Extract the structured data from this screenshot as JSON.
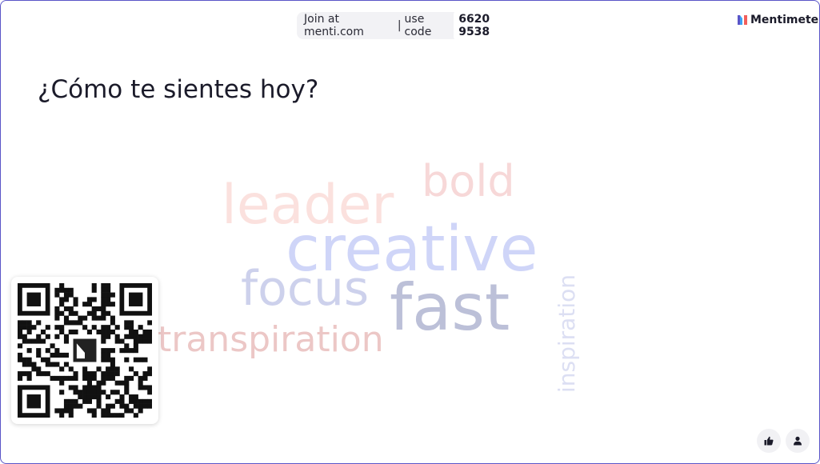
{
  "header": {
    "join_prefix": "Join at menti.com",
    "separator": "|",
    "use_code_label": "use code",
    "code": "6620 9538"
  },
  "brand": {
    "name": "Mentimeter",
    "logo_icon": "mentimeter-logo-icon"
  },
  "question": "¿Cómo te sientes hoy?",
  "word_cloud": {
    "words": [
      {
        "text": "bold",
        "color": "#f7d8d8"
      },
      {
        "text": "leader",
        "color": "#fbe1de"
      },
      {
        "text": "creative",
        "color": "#cfd5f8"
      },
      {
        "text": "focus",
        "color": "#cdd1ec"
      },
      {
        "text": "fast",
        "color": "#bcc0d8"
      },
      {
        "text": "transpiration",
        "color": "#ecc7c6"
      },
      {
        "text": "inspiration",
        "color": "#dcdff3"
      }
    ]
  },
  "qr": {
    "icon": "qr-code-icon"
  },
  "controls": [
    {
      "icon": "thumbs-up-icon"
    },
    {
      "icon": "user-icon"
    }
  ],
  "colors": {
    "frame_border": "#5a55c8",
    "pill_bg": "#f2f2f5",
    "text": "#1b1b2a"
  }
}
